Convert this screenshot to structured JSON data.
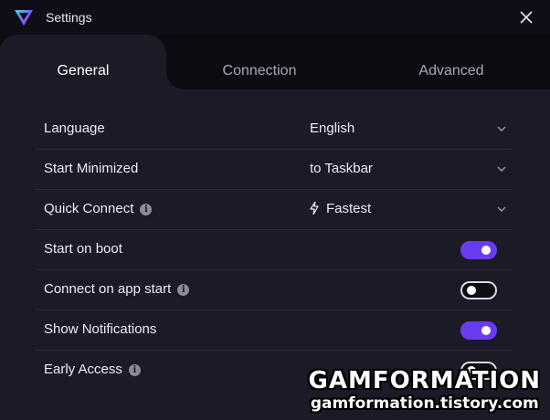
{
  "window": {
    "title": "Settings"
  },
  "tabs": [
    {
      "label": "General",
      "active": true
    },
    {
      "label": "Connection",
      "active": false
    },
    {
      "label": "Advanced",
      "active": false
    }
  ],
  "settings": {
    "language": {
      "label": "Language",
      "value": "English"
    },
    "start_minimized": {
      "label": "Start Minimized",
      "value": "to Taskbar"
    },
    "quick_connect": {
      "label": "Quick Connect",
      "value": "Fastest",
      "icon": "lightning-icon"
    },
    "start_on_boot": {
      "label": "Start on boot",
      "enabled": true
    },
    "connect_on_app_start": {
      "label": "Connect on app start",
      "enabled": false
    },
    "show_notifications": {
      "label": "Show Notifications",
      "enabled": true
    },
    "early_access": {
      "label": "Early Access",
      "enabled": false
    }
  },
  "watermark": {
    "title": "GAMFORMATION",
    "url": "gamformation.tistory.com"
  },
  "colors": {
    "accent": "#6a3cf0",
    "background": "#1c1a27",
    "titlebar": "#0f0e16"
  }
}
